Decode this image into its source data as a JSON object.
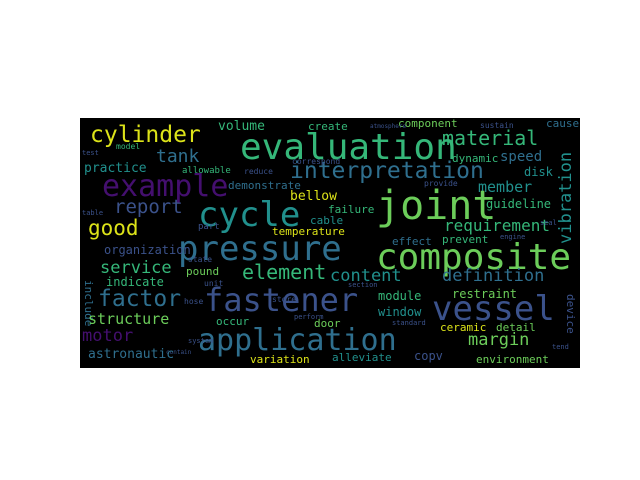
{
  "palette": {
    "background": "#000000",
    "purple": "#440f6f",
    "indigo": "#3b528b",
    "blue": "#2f6f8e",
    "teal": "#21908d",
    "green": "#35b779",
    "lime": "#6ccd5a",
    "yellow": "#dce319"
  },
  "words": [
    {
      "text": "evaluation",
      "color": "#35b779"
    },
    {
      "text": "cylinder",
      "color": "#dce319"
    },
    {
      "text": "example",
      "color": "#440f6f"
    },
    {
      "text": "interpretation",
      "color": "#2f6f8e"
    },
    {
      "text": "cycle",
      "color": "#21908d"
    },
    {
      "text": "joint",
      "color": "#6ccd5a"
    },
    {
      "text": "report",
      "color": "#dce319"
    },
    {
      "text": "good",
      "color": "#3b528b"
    },
    {
      "text": "pressure",
      "color": "#2f6f8e"
    },
    {
      "text": "composite",
      "color": "#6ccd5a"
    },
    {
      "text": "vessel",
      "color": "#3b528b"
    },
    {
      "text": "fastener",
      "color": "#3b528b"
    },
    {
      "text": "element",
      "color": "#35b779"
    },
    {
      "text": "factor",
      "color": "#2f6f8e"
    },
    {
      "text": "application",
      "color": "#2f6f8e"
    },
    {
      "text": "material",
      "color": "#35b779"
    },
    {
      "text": "tank",
      "color": "#2f6f8e"
    },
    {
      "text": "member",
      "color": "#21908d"
    },
    {
      "text": "requirement",
      "color": "#35b779"
    },
    {
      "text": "content",
      "color": "#21908d"
    },
    {
      "text": "definition",
      "color": "#2f6f8e"
    },
    {
      "text": "structure",
      "color": "#6ccd5a"
    },
    {
      "text": "motor",
      "color": "#440f6f"
    },
    {
      "text": "margin",
      "color": "#6ccd5a"
    },
    {
      "text": "service",
      "color": "#35b779"
    },
    {
      "text": "vibration",
      "color": "#21908d"
    },
    {
      "text": "volume",
      "color": "#35b779"
    },
    {
      "text": "practice",
      "color": "#21908d"
    },
    {
      "text": "dynamic",
      "color": "#35b779"
    },
    {
      "text": "speed",
      "color": "#2f6f8e"
    },
    {
      "text": "disk",
      "color": "#21908d"
    },
    {
      "text": "guideline",
      "color": "#35b779"
    },
    {
      "text": "demonstrate",
      "color": "#2f6f8e"
    },
    {
      "text": "bellow",
      "color": "#dce319"
    },
    {
      "text": "failure",
      "color": "#35b779"
    },
    {
      "text": "cable",
      "color": "#21908d"
    },
    {
      "text": "temperature",
      "color": "#dce319"
    },
    {
      "text": "organization",
      "color": "#3b528b"
    },
    {
      "text": "effect",
      "color": "#2f6f8e"
    },
    {
      "text": "prevent",
      "color": "#35b779"
    },
    {
      "text": "indicate",
      "color": "#35b779"
    },
    {
      "text": "pound",
      "color": "#6ccd5a"
    },
    {
      "text": "module",
      "color": "#35b779"
    },
    {
      "text": "restraint",
      "color": "#6ccd5a"
    },
    {
      "text": "window",
      "color": "#21908d"
    },
    {
      "text": "occur",
      "color": "#35b779"
    },
    {
      "text": "door",
      "color": "#6ccd5a"
    },
    {
      "text": "ceramic",
      "color": "#dce319"
    },
    {
      "text": "detail",
      "color": "#6ccd5a"
    },
    {
      "text": "astronautic",
      "color": "#2f6f8e"
    },
    {
      "text": "variation",
      "color": "#dce319"
    },
    {
      "text": "alleviate",
      "color": "#21908d"
    },
    {
      "text": "copv",
      "color": "#3b528b"
    },
    {
      "text": "environment",
      "color": "#6ccd5a"
    },
    {
      "text": "component",
      "color": "#6ccd5a"
    },
    {
      "text": "create",
      "color": "#35b779"
    },
    {
      "text": "cause",
      "color": "#2f6f8e"
    },
    {
      "text": "device",
      "color": "#3b528b"
    },
    {
      "text": "include",
      "color": "#2f6f8e"
    },
    {
      "text": "section",
      "color": "#3b528b"
    },
    {
      "text": "allowable",
      "color": "#35b779"
    },
    {
      "text": "model",
      "color": "#35b779"
    },
    {
      "text": "sustain",
      "color": "#3b528b"
    },
    {
      "text": "provide",
      "color": "#3b528b"
    },
    {
      "text": "correspond",
      "color": "#3b528b"
    },
    {
      "text": "reduce",
      "color": "#3b528b"
    },
    {
      "text": "perform",
      "color": "#3b528b"
    },
    {
      "text": "standard",
      "color": "#3b528b"
    },
    {
      "text": "state",
      "color": "#3b528b"
    },
    {
      "text": "test",
      "color": "#3b528b"
    },
    {
      "text": "system",
      "color": "#3b528b"
    },
    {
      "text": "unit",
      "color": "#3b528b"
    },
    {
      "text": "store",
      "color": "#3b528b"
    },
    {
      "text": "hose",
      "color": "#3b528b"
    },
    {
      "text": "table",
      "color": "#3b528b"
    },
    {
      "text": "seal",
      "color": "#3b528b"
    },
    {
      "text": "engine",
      "color": "#3b528b"
    },
    {
      "text": "tend",
      "color": "#3b528b"
    },
    {
      "text": "part",
      "color": "#3b528b"
    },
    {
      "text": "contain",
      "color": "#3b528b"
    },
    {
      "text": "atmosphere",
      "color": "#3b528b"
    }
  ]
}
